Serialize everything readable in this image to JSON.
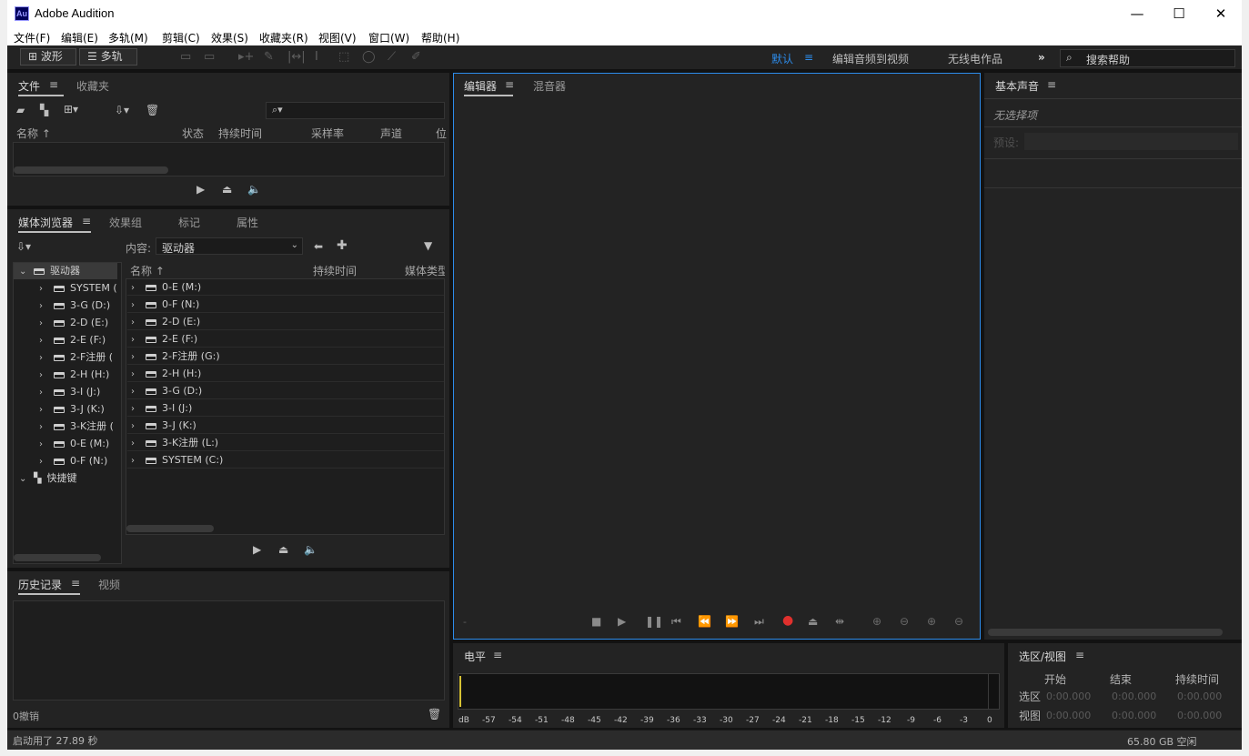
{
  "window": {
    "title": "Adobe Audition",
    "logo_text": "Au",
    "controls": {
      "minimize": "—",
      "maximize": "☐",
      "close": "✕"
    }
  },
  "menu": [
    "文件(F)",
    "编辑(E)",
    "多轨(M)",
    "剪辑(C)",
    "效果(S)",
    "收藏夹(R)",
    "视图(V)",
    "窗口(W)",
    "帮助(H)"
  ],
  "toolbar": {
    "waveform_label": "波形",
    "multitrack_label": "多轨",
    "workspaces": [
      "默认",
      "编辑音频到视频",
      "无线电作品"
    ],
    "more": "»",
    "search_placeholder": "搜索帮助"
  },
  "files_panel": {
    "tabs": [
      "文件",
      "收藏夹"
    ],
    "columns": [
      "名称 ↑",
      "状态",
      "持续时间",
      "采样率",
      "声道",
      "位"
    ]
  },
  "media_panel": {
    "tabs": [
      "媒体浏览器",
      "效果组",
      "标记",
      "属性"
    ],
    "content_label": "内容:",
    "content_value": "驱动器",
    "list_columns": [
      "名称 ↑",
      "持续时间",
      "媒体类型"
    ],
    "tree_root": "驱动器",
    "tree_items": [
      "SYSTEM (",
      "3-G (D:)",
      "2-D (E:)",
      "2-E (F:)",
      "2-F注册 (",
      "2-H (H:)",
      "3-I (J:)",
      "3-J (K:)",
      "3-K注册 (",
      "0-E (M:)",
      "0-F (N:)"
    ],
    "tree_shortcut": "快捷键",
    "list_items": [
      "0-E (M:)",
      "0-F (N:)",
      "2-D (E:)",
      "2-E (F:)",
      "2-F注册 (G:)",
      "2-H (H:)",
      "3-G (D:)",
      "3-I (J:)",
      "3-J (K:)",
      "3-K注册 (L:)",
      "SYSTEM (C:)"
    ]
  },
  "history_panel": {
    "tabs": [
      "历史记录",
      "视频"
    ],
    "undo_label": "0撤销"
  },
  "editor_panel": {
    "tabs": [
      "编辑器",
      "混音器"
    ],
    "time_display": "-"
  },
  "essential_sound": {
    "title": "基本声音",
    "no_selection": "无选择项",
    "preset_label": "预设:"
  },
  "level_panel": {
    "title": "电平",
    "scale": [
      "dB",
      "-57",
      "-54",
      "-51",
      "-48",
      "-45",
      "-42",
      "-39",
      "-36",
      "-33",
      "-30",
      "-27",
      "-24",
      "-21",
      "-18",
      "-15",
      "-12",
      "-9",
      "-6",
      "-3",
      "0"
    ]
  },
  "selection_view": {
    "title": "选区/视图",
    "columns": [
      "开始",
      "结束",
      "持续时间"
    ],
    "rows": [
      {
        "label": "选区",
        "values": [
          "0:00.000",
          "0:00.000",
          "0:00.000"
        ]
      },
      {
        "label": "视图",
        "values": [
          "0:00.000",
          "0:00.000",
          "0:00.000"
        ]
      }
    ]
  },
  "status": {
    "startup": "启动用了 27.89 秒",
    "disk_free": "65.80 GB 空闲"
  },
  "colors": {
    "accent_blue": "#2d8ceb",
    "record_red": "#e0302d",
    "panel_bg": "#232323"
  }
}
